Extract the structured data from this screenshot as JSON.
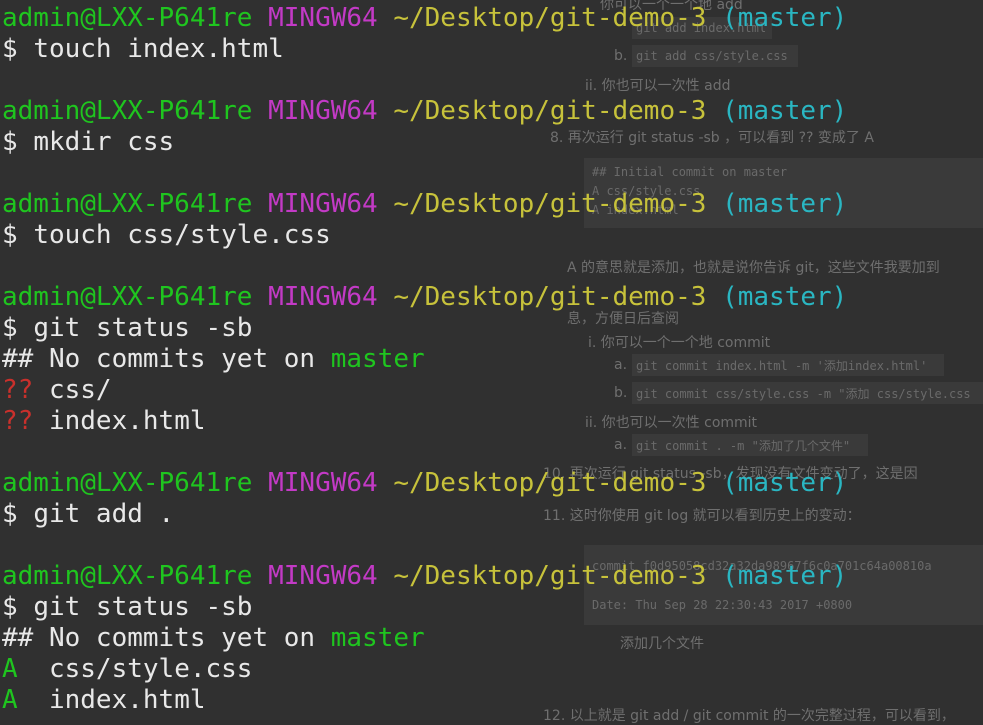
{
  "prompt": {
    "user_host": "admin@LXX-P641re",
    "shell": "MINGW64",
    "path": "~/Desktop/git-demo-3",
    "branch": "(master)",
    "symbol": "$"
  },
  "commands": {
    "c1": "touch index.html",
    "c2": "mkdir css",
    "c3": "touch css/style.css",
    "c4": "git status -sb",
    "c5": "git add .",
    "c6": "git status -sb"
  },
  "status1": {
    "header_prefix": "## No commits yet on ",
    "branch": "master",
    "line1_mark": "??",
    "line1_file": " css/",
    "line2_mark": "??",
    "line2_file": " index.html"
  },
  "status2": {
    "header_prefix": "## No commits yet on ",
    "branch": "master",
    "line1_mark": "A",
    "line1_file": "  css/style.css",
    "line2_mark": "A",
    "line2_file": "  index.html"
  },
  "background_doc": {
    "l1": "你可以一个一个地 add",
    "l2": "git add index.html",
    "l3_prefix": "b. ",
    "l3": "git add css/style.css",
    "l4": "ii. 你也可以一次性 add",
    "l5": "8. 再次运行 git status -sb ，可以看到 ?? 变成了 A",
    "l6": "## Initial commit on master",
    "l7": "A  css/style.css",
    "l8": "A  index.html",
    "l9": "A 的意思就是添加，也就是说你告诉 git，这些文件我要加到",
    "l10": "息，方便日后查阅",
    "l11": "i. 你可以一个一个地 commit",
    "l12_prefix": "a. ",
    "l12": "git commit index.html -m '添加index.html'",
    "l13_prefix": "b. ",
    "l13": "git commit css/style.css -m \"添加 css/style.css",
    "l14": "ii. 你也可以一次性 commit",
    "l15_prefix": "a. ",
    "l15": "git commit . -m \"添加了几个文件\"",
    "l16": "10. 再次运行 git status -sb，发现没有文件变动了，这是因",
    "l17": "11. 这时你使用 git log 就可以看到历史上的变动：",
    "l18": "commit f0d95058cd32a32da98967f6c0a701c64a00810a",
    "l19": "Date:   Thu Sep 28 22:30:43 2017 +0800",
    "l20": "添加几个文件",
    "l21": "12. 以上就是 git add / git commit 的一次完整过程，可以看到，"
  }
}
